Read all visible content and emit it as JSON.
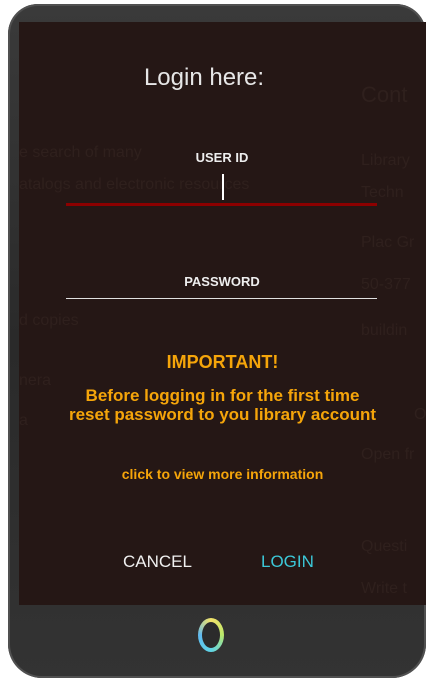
{
  "background_page": {
    "heading": "Cont",
    "lines_left": [
      "e search of many",
      "atalogs and electronic resources",
      "d copies",
      "nera",
      "a"
    ],
    "lines_right": [
      "Library",
      "Techn",
      "Plac Gr",
      "50-377",
      "buildin",
      "O",
      "Open fr",
      "Questi",
      "Write t"
    ]
  },
  "login": {
    "title": "Login here:",
    "user_id_label": "USER ID",
    "password_label": "PASSWORD",
    "user_id_value": "",
    "password_value": ""
  },
  "notice": {
    "important": "IMPORTANT!",
    "line1": "Before logging in for the first time",
    "line2": "reset password to you library account",
    "more_info": "click to view more information"
  },
  "buttons": {
    "cancel": "CANCEL",
    "login": "LOGIN"
  },
  "colors": {
    "screen_bg": "#251715",
    "accent_orange": "#f5a50a",
    "login_cyan": "#3cc8d8",
    "underline_red": "#8c0000"
  }
}
